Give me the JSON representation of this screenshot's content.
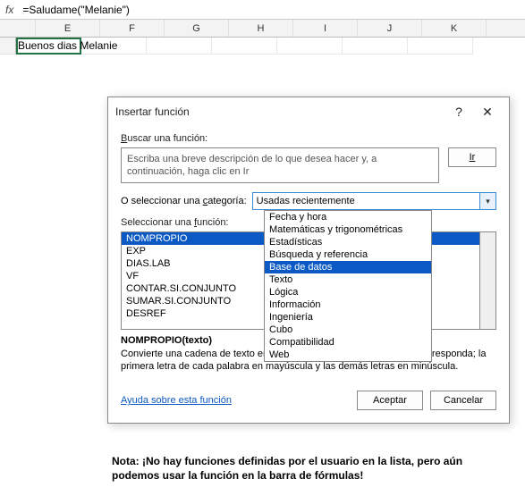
{
  "formula_bar": {
    "fx_label": "fx",
    "value": "=Saludame(\"Melanie\")"
  },
  "columns": [
    "E",
    "F",
    "G",
    "H",
    "I",
    "J",
    "K"
  ],
  "active_cell_value": "Buenos dias Melanie",
  "dialog": {
    "title": "Insertar función",
    "help_symbol": "?",
    "close_symbol": "✕",
    "search_label_pre": "B",
    "search_label_rest": "uscar una función:",
    "search_placeholder": "Escriba una breve descripción de lo que desea hacer y, a continuación, haga clic en Ir",
    "go_label": "Ir",
    "category_label_pre": "O seleccionar una ",
    "category_label_u": "c",
    "category_label_post": "ategoría:",
    "category_selected": "Usadas recientemente",
    "category_options": [
      "Fecha y hora",
      "Matemáticas y trigonométricas",
      "Estadísticas",
      "Búsqueda y referencia",
      "Base de datos",
      "Texto",
      "Lógica",
      "Información",
      "Ingeniería",
      "Cubo",
      "Compatibilidad",
      "Web"
    ],
    "category_highlight_index": 4,
    "func_label_pre": "Seleccionar una ",
    "func_label_u": "f",
    "func_label_post": "unción:",
    "functions": [
      "NOMPROPIO",
      "EXP",
      "DIAS.LAB",
      "VF",
      "CONTAR.SI.CONJUNTO",
      "SUMAR.SI.CONJUNTO",
      "DESREF"
    ],
    "func_signature": "NOMPROPIO(texto)",
    "func_description": "Convierte una cadena de texto en mayúsculas o minúsculas, según corresponda; la primera letra de cada palabra en mayúscula y las demás letras en minúscula.",
    "help_link": "Ayuda sobre esta función",
    "ok_label": "Aceptar",
    "cancel_label": "Cancelar"
  },
  "note": "Nota: ¡No hay funciones definidas por el usuario en la lista, pero aún podemos usar la función en la barra de fórmulas!"
}
